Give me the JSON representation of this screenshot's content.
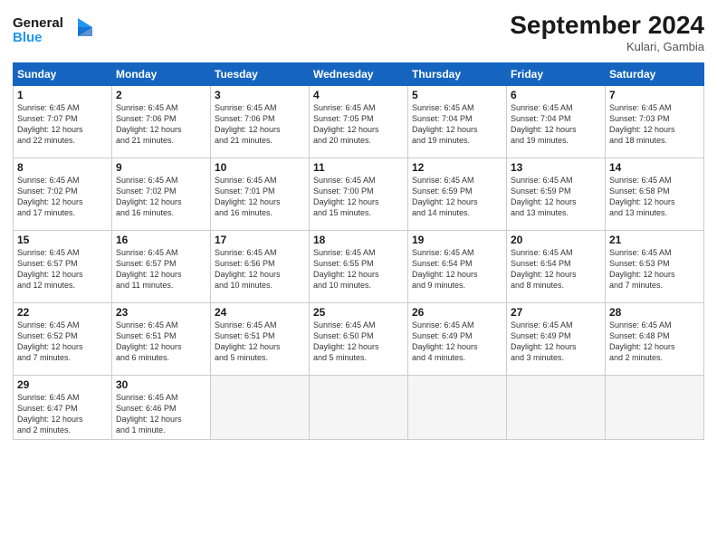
{
  "logo": {
    "line1": "General",
    "line2": "Blue"
  },
  "title": "September 2024",
  "subtitle": "Kulari, Gambia",
  "days_of_week": [
    "Sunday",
    "Monday",
    "Tuesday",
    "Wednesday",
    "Thursday",
    "Friday",
    "Saturday"
  ],
  "weeks": [
    [
      {
        "day": "1",
        "info": "Sunrise: 6:45 AM\nSunset: 7:07 PM\nDaylight: 12 hours\nand 22 minutes."
      },
      {
        "day": "2",
        "info": "Sunrise: 6:45 AM\nSunset: 7:06 PM\nDaylight: 12 hours\nand 21 minutes."
      },
      {
        "day": "3",
        "info": "Sunrise: 6:45 AM\nSunset: 7:06 PM\nDaylight: 12 hours\nand 21 minutes."
      },
      {
        "day": "4",
        "info": "Sunrise: 6:45 AM\nSunset: 7:05 PM\nDaylight: 12 hours\nand 20 minutes."
      },
      {
        "day": "5",
        "info": "Sunrise: 6:45 AM\nSunset: 7:04 PM\nDaylight: 12 hours\nand 19 minutes."
      },
      {
        "day": "6",
        "info": "Sunrise: 6:45 AM\nSunset: 7:04 PM\nDaylight: 12 hours\nand 19 minutes."
      },
      {
        "day": "7",
        "info": "Sunrise: 6:45 AM\nSunset: 7:03 PM\nDaylight: 12 hours\nand 18 minutes."
      }
    ],
    [
      {
        "day": "8",
        "info": "Sunrise: 6:45 AM\nSunset: 7:02 PM\nDaylight: 12 hours\nand 17 minutes."
      },
      {
        "day": "9",
        "info": "Sunrise: 6:45 AM\nSunset: 7:02 PM\nDaylight: 12 hours\nand 16 minutes."
      },
      {
        "day": "10",
        "info": "Sunrise: 6:45 AM\nSunset: 7:01 PM\nDaylight: 12 hours\nand 16 minutes."
      },
      {
        "day": "11",
        "info": "Sunrise: 6:45 AM\nSunset: 7:00 PM\nDaylight: 12 hours\nand 15 minutes."
      },
      {
        "day": "12",
        "info": "Sunrise: 6:45 AM\nSunset: 6:59 PM\nDaylight: 12 hours\nand 14 minutes."
      },
      {
        "day": "13",
        "info": "Sunrise: 6:45 AM\nSunset: 6:59 PM\nDaylight: 12 hours\nand 13 minutes."
      },
      {
        "day": "14",
        "info": "Sunrise: 6:45 AM\nSunset: 6:58 PM\nDaylight: 12 hours\nand 13 minutes."
      }
    ],
    [
      {
        "day": "15",
        "info": "Sunrise: 6:45 AM\nSunset: 6:57 PM\nDaylight: 12 hours\nand 12 minutes."
      },
      {
        "day": "16",
        "info": "Sunrise: 6:45 AM\nSunset: 6:57 PM\nDaylight: 12 hours\nand 11 minutes."
      },
      {
        "day": "17",
        "info": "Sunrise: 6:45 AM\nSunset: 6:56 PM\nDaylight: 12 hours\nand 10 minutes."
      },
      {
        "day": "18",
        "info": "Sunrise: 6:45 AM\nSunset: 6:55 PM\nDaylight: 12 hours\nand 10 minutes."
      },
      {
        "day": "19",
        "info": "Sunrise: 6:45 AM\nSunset: 6:54 PM\nDaylight: 12 hours\nand 9 minutes."
      },
      {
        "day": "20",
        "info": "Sunrise: 6:45 AM\nSunset: 6:54 PM\nDaylight: 12 hours\nand 8 minutes."
      },
      {
        "day": "21",
        "info": "Sunrise: 6:45 AM\nSunset: 6:53 PM\nDaylight: 12 hours\nand 7 minutes."
      }
    ],
    [
      {
        "day": "22",
        "info": "Sunrise: 6:45 AM\nSunset: 6:52 PM\nDaylight: 12 hours\nand 7 minutes."
      },
      {
        "day": "23",
        "info": "Sunrise: 6:45 AM\nSunset: 6:51 PM\nDaylight: 12 hours\nand 6 minutes."
      },
      {
        "day": "24",
        "info": "Sunrise: 6:45 AM\nSunset: 6:51 PM\nDaylight: 12 hours\nand 5 minutes."
      },
      {
        "day": "25",
        "info": "Sunrise: 6:45 AM\nSunset: 6:50 PM\nDaylight: 12 hours\nand 5 minutes."
      },
      {
        "day": "26",
        "info": "Sunrise: 6:45 AM\nSunset: 6:49 PM\nDaylight: 12 hours\nand 4 minutes."
      },
      {
        "day": "27",
        "info": "Sunrise: 6:45 AM\nSunset: 6:49 PM\nDaylight: 12 hours\nand 3 minutes."
      },
      {
        "day": "28",
        "info": "Sunrise: 6:45 AM\nSunset: 6:48 PM\nDaylight: 12 hours\nand 2 minutes."
      }
    ],
    [
      {
        "day": "29",
        "info": "Sunrise: 6:45 AM\nSunset: 6:47 PM\nDaylight: 12 hours\nand 2 minutes."
      },
      {
        "day": "30",
        "info": "Sunrise: 6:45 AM\nSunset: 6:46 PM\nDaylight: 12 hours\nand 1 minute."
      },
      {
        "day": "",
        "info": ""
      },
      {
        "day": "",
        "info": ""
      },
      {
        "day": "",
        "info": ""
      },
      {
        "day": "",
        "info": ""
      },
      {
        "day": "",
        "info": ""
      }
    ]
  ]
}
